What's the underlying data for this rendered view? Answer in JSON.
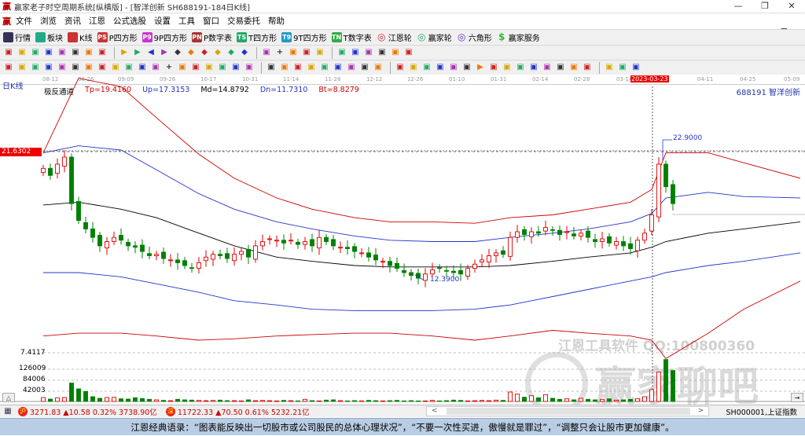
{
  "window": {
    "title": "赢家老子时空周期系统[纵横版] - [智洋创新  SH688191-184日K线]",
    "logo": "赢",
    "min": "—",
    "restore": "❐",
    "close": "✕"
  },
  "menu": {
    "logo": "赢",
    "items": [
      "文件",
      "浏览",
      "资讯",
      "江恩",
      "公式选股",
      "设置",
      "工具",
      "窗口",
      "交易委托",
      "帮助"
    ],
    "mdi": [
      "_",
      "❐",
      "×"
    ]
  },
  "toolbar1": [
    {
      "label": "行情",
      "icon": "quote-table-icon",
      "color": "#335"
    },
    {
      "label": "板块",
      "icon": "sector-icon",
      "color": "#2a8"
    },
    {
      "label": "K线",
      "icon": "kline-icon",
      "color": "#c33"
    },
    {
      "label": "P四方形",
      "icon": "p-square-icon",
      "color": "#c33",
      "glyph": "PS"
    },
    {
      "label": "9P四方形",
      "icon": "9p-square-icon",
      "color": "#c3c",
      "glyph": "P9"
    },
    {
      "label": "P数字表",
      "icon": "p-number-table-icon",
      "color": "#a33",
      "glyph": "PN"
    },
    {
      "label": "T四方形",
      "icon": "t-square-icon",
      "color": "#2a6",
      "glyph": "TS"
    },
    {
      "label": "9T四方形",
      "icon": "9t-square-icon",
      "color": "#29c",
      "glyph": "T9"
    },
    {
      "label": "T数字表",
      "icon": "t-number-table-icon",
      "color": "#3a4",
      "glyph": "TN"
    },
    {
      "label": "江恩轮",
      "icon": "gann-wheel-icon",
      "color": "#c33",
      "glyph": "◎"
    },
    {
      "label": "赢家轮",
      "icon": "winner-wheel-icon",
      "color": "#3a6",
      "glyph": "◎"
    },
    {
      "label": "六角形",
      "icon": "hexagon-icon",
      "color": "#63c",
      "glyph": "◎"
    },
    {
      "label": "赢家服务",
      "icon": "dollar-icon",
      "color": "#3b3",
      "glyph": "$"
    }
  ],
  "toolbar2_icons": [
    "day-period-dropdown-icon",
    "chart-style-icon",
    "doc-icon",
    "indicator-icon",
    "indicator2-icon",
    "candle-dropdown-icon",
    "rehab-icon",
    "color-icon",
    "first-bar-icon",
    "last-bar-icon",
    "left-arrow-icon",
    "right-arrow-icon",
    "diamond-icon",
    "diamond-up-icon",
    "diamond-lr-icon",
    "diamond-expand-icon",
    "diamond-shrink-icon",
    "diamond-all-icon",
    "hand-icon",
    "crosshair-icon",
    "trend-icon",
    "gift-icon",
    "globe-icon",
    "calendar-icon",
    "calculator-icon",
    "report-icon",
    "save-icon",
    "network-icon",
    "printer-icon"
  ],
  "toolbar3_icons": [
    "pen-icon",
    "parallel-icon",
    "gold-line-icon",
    "gold-line2-icon",
    "fib-icon",
    "fan-icon",
    "cycle-icon",
    "circle-icon",
    "lines-icon",
    "square-n-icon",
    "angle-icon",
    "target-icon",
    "cross-icon",
    "box-icon",
    "speed-icon",
    "red-lines-icon",
    "red-lines2-icon",
    "grid-icon",
    "channel-icon",
    "rect-icon",
    "ray-icon",
    "color-box-icon",
    "color-box2-icon",
    "angle2-icon",
    "v-icon",
    "table-icon",
    "table2-icon",
    "wave-icon",
    "ruler-icon",
    "percent-line-icon",
    "percent-icon",
    "pct-line-icon",
    "gold-circle-icon",
    "gold-line3-icon",
    "arrow-up-icon",
    "box-line-icon",
    "gold-box-icon",
    "angle3-icon",
    "angle4-icon",
    "angle5-icon",
    "angle6-icon",
    "angle7-icon",
    "angle8-icon",
    "grid2-icon",
    "taiji-icon",
    "infinity-icon"
  ],
  "chart": {
    "period_label": "日K线",
    "indicator": "极反通道",
    "tp": "Tp=19.4160",
    "up": "Up=17.3153",
    "md": "Md=14.8792",
    "dn": "Dn=11.7310",
    "bt": "Bt=8.8279",
    "stock": "688191  智洋创新",
    "price_tag": "21.6302",
    "high_label": "22.9000",
    "low_label": "12.3900",
    "ylabel_low": "7.4117",
    "vol_ticks": [
      "126009",
      "84006",
      "42003"
    ],
    "dates": [
      "08-12",
      "08-26",
      "09-09",
      "09-26",
      "10-17",
      "10-31",
      "11-14",
      "11-28",
      "12-12",
      "12-26",
      "01-10",
      "01-31",
      "02-14",
      "02-28",
      "03-14",
      "2023-03-23",
      "04-11",
      "04-25",
      "05-09"
    ],
    "collapse": "△",
    "expand": "→"
  },
  "chart_data": {
    "type": "candlestick",
    "title": "SH688191-184日K线",
    "ylim": [
      7.41,
      27.1
    ],
    "closes": [
      20.5,
      20.0,
      20.8,
      21.3,
      18.0,
      16.8,
      16.2,
      15.6,
      15.0,
      15.3,
      15.6,
      15.4,
      15.0,
      14.9,
      14.6,
      14.3,
      14.4,
      14.1,
      14.0,
      13.8,
      13.6,
      13.4,
      13.8,
      14.2,
      14.4,
      14.3,
      14.1,
      14.4,
      14.6,
      14.2,
      15.0,
      15.3,
      15.5,
      15.4,
      15.2,
      15.4,
      15.1,
      15.3,
      15.0,
      15.6,
      15.3,
      15.0,
      14.9,
      14.8,
      14.6,
      14.5,
      14.2,
      14.0,
      13.9,
      13.6,
      13.4,
      13.1,
      12.9,
      12.7,
      13.0,
      13.3,
      13.4,
      13.2,
      13.1,
      13.0,
      13.4,
      13.7,
      14.0,
      14.3,
      14.5,
      14.4,
      15.6,
      16.0,
      15.8,
      16.0,
      15.9,
      16.3,
      16.1,
      15.8,
      16.0,
      15.7,
      15.9,
      15.6,
      15.3,
      15.5,
      15.2,
      15.3,
      15.0,
      14.8,
      15.4,
      15.9,
      17.2,
      20.8,
      19.2,
      18.0
    ],
    "volumes": [
      15000,
      9000,
      14000,
      15000,
      70000,
      48000,
      38000,
      18000,
      12000,
      15000,
      16000,
      10000,
      9000,
      14000,
      11000,
      8000,
      6000,
      4000,
      3000,
      8000,
      6000,
      5000,
      4000,
      3000,
      4000,
      5000,
      3000,
      3000,
      2000,
      6000,
      3000,
      4000,
      3000,
      2000,
      4000,
      3000,
      2000,
      8000,
      3000,
      2000,
      5000,
      6000,
      3000,
      2000,
      3000,
      2000,
      4000,
      3000,
      2000,
      3000,
      4000,
      2000,
      3000,
      2000,
      2000,
      4000,
      2000,
      3000,
      5000,
      4000,
      2000,
      3000,
      4000,
      3000,
      5000,
      4000,
      36000,
      28000,
      16000,
      22000,
      14000,
      26000,
      12000,
      8000,
      10000,
      6000,
      12000,
      8000,
      6000,
      8000,
      10000,
      5000,
      6000,
      8000,
      10000,
      18000,
      45000,
      112000,
      160000,
      118000
    ],
    "vol_max": 168000,
    "bands": {
      "bar_index": [
        0,
        5,
        11,
        16,
        22,
        27,
        33,
        38,
        44,
        49,
        55,
        61,
        66,
        72,
        77,
        83,
        86,
        88,
        94,
        99,
        107
      ],
      "Tp": [
        21.6,
        26.9,
        26.3,
        24.1,
        21.5,
        19.8,
        18.4,
        17.6,
        17.0,
        16.7,
        16.7,
        16.6,
        17.0,
        17.2,
        17.6,
        18.1,
        19.0,
        21.6,
        21.6,
        20.9,
        19.8
      ],
      "Up": [
        21.6,
        22.1,
        21.8,
        20.4,
        18.7,
        17.6,
        16.7,
        16.2,
        15.7,
        15.4,
        15.3,
        15.3,
        15.6,
        15.9,
        16.2,
        16.7,
        17.3,
        18.4,
        18.8,
        18.5,
        18.4
      ],
      "Md": [
        17.9,
        18.1,
        17.6,
        17.0,
        15.9,
        15.0,
        14.2,
        13.9,
        13.6,
        13.5,
        13.5,
        13.5,
        13.6,
        13.9,
        14.2,
        14.5,
        14.9,
        15.3,
        15.9,
        16.2,
        16.7
      ],
      "Dn": [
        13.1,
        13.1,
        12.8,
        12.3,
        11.7,
        11.1,
        10.8,
        10.5,
        10.4,
        10.4,
        10.4,
        10.5,
        10.8,
        11.4,
        11.9,
        12.5,
        12.8,
        13.1,
        13.6,
        13.9,
        14.5
      ],
      "Bt": [
        8.6,
        8.8,
        8.8,
        8.6,
        8.3,
        8.4,
        8.6,
        8.7,
        8.8,
        8.8,
        8.6,
        8.3,
        8.6,
        9.0,
        8.8,
        8.6,
        8.3,
        7.0,
        8.8,
        10.5,
        12.5
      ]
    },
    "colors": {
      "up": "#e00000",
      "down": "#008000",
      "Tp": "#cc0000",
      "Up": "#2233cc",
      "Md": "#000000",
      "Dn": "#2233cc",
      "Bt": "#cc0000"
    }
  },
  "watermark": {
    "line1": "江恩工具软件  QQ:100800360",
    "line2": "赢家聊吧"
  },
  "status": {
    "sh_badge": "沪",
    "sh": "3271.83 ▲10.58 0.32% 3738.90亿",
    "sz_badge": "深",
    "sz": "11722.33 ▲70.50 0.61% 5232.21亿",
    "scroll_left": "<",
    "scroll_right": ">",
    "index": "SH000001,上证指数"
  },
  "quote": "江恩经典语录：“图表能反映出一切股市或公司股民的总体心理状况”，“不要一次性买进，傲慢就是罪过”，“调整只会让股市更加健康”。"
}
